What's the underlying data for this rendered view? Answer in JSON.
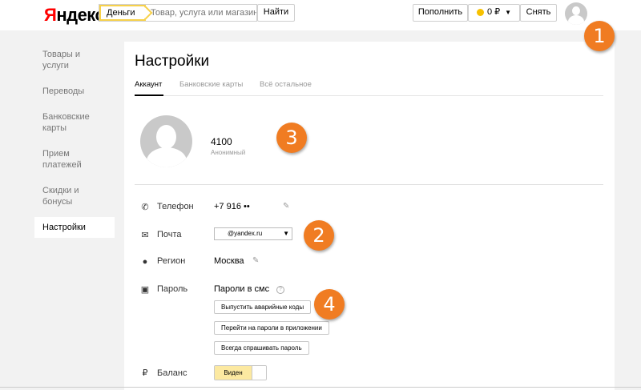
{
  "header": {
    "logo": "Яндекс",
    "search": {
      "service": "Деньги",
      "placeholder": "Товар, услуга или магазин",
      "button": "Найти"
    },
    "topup": "Пополнить",
    "balance": "0 ₽",
    "withdraw": "Снять"
  },
  "sidebar": {
    "items": [
      {
        "label": "Товары и услуги"
      },
      {
        "label": "Переводы"
      },
      {
        "label": "Банковские карты"
      },
      {
        "label": "Прием платежей"
      },
      {
        "label": "Скидки и бонусы"
      },
      {
        "label": "Настройки"
      }
    ]
  },
  "main": {
    "title": "Настройки",
    "tabs": [
      {
        "label": "Аккаунт"
      },
      {
        "label": "Банковские карты"
      },
      {
        "label": "Всё остальное"
      }
    ],
    "profile": {
      "id": "4100",
      "role": "Анонимный"
    },
    "rows": {
      "phone": {
        "label": "Телефон",
        "value": "+7 916 ••"
      },
      "email": {
        "label": "Почта",
        "value": "@yandex.ru"
      },
      "region": {
        "label": "Регион",
        "value": "Москва"
      },
      "password": {
        "label": "Пароль",
        "value": "Пароли в смс",
        "help": "?"
      },
      "balance": {
        "label": "Баланс",
        "toggle": "Виден"
      }
    },
    "password_buttons": [
      "Выпустить аварийные коды",
      "Перейти на пароли в приложении",
      "Всегда спрашивать пароль"
    ]
  },
  "annotations": [
    "1",
    "2",
    "3",
    "4"
  ],
  "colors": {
    "accent_yellow": "#f7d14a",
    "brand_red": "#ff0000",
    "badge_orange": "#f07c22",
    "toggle_on": "#fce9a1"
  }
}
